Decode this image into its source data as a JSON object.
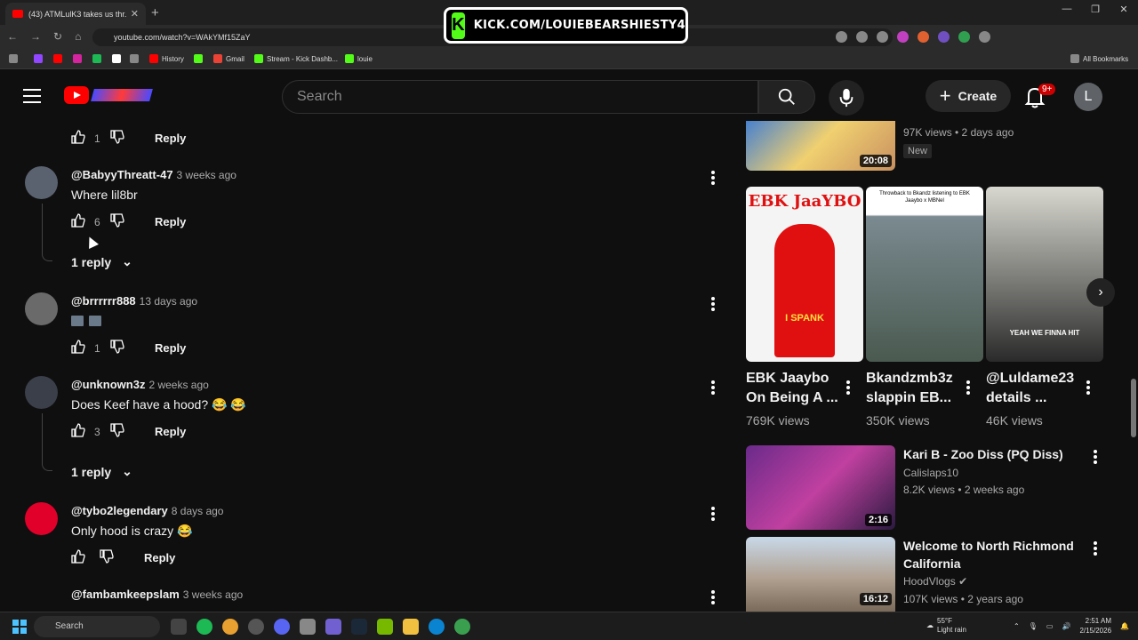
{
  "browser": {
    "tab_title": "(43) ATMLulK3 takes us thr...",
    "url": "youtube.com/watch?v=WAkYMf15ZaY",
    "bookmarks": [
      "History",
      "Gmail",
      "Stream - Kick Dashb...",
      "louie"
    ],
    "all_bookmarks": "All Bookmarks"
  },
  "overlay": {
    "kick_url": "KICK.COM/LOUIEBEARSHIESTY4"
  },
  "header": {
    "search_placeholder": "Search",
    "create_label": "Create",
    "notif_count": "9+",
    "avatar_letter": "L"
  },
  "comments": [
    {
      "likes": "1",
      "reply_label": "Reply"
    },
    {
      "handle": "@BabyyThreatt-47",
      "time": "3 weeks ago",
      "text": "Where lil8br",
      "likes": "6",
      "reply_label": "Reply",
      "replies": "1 reply"
    },
    {
      "handle": "@brrrrrr888",
      "time": "13 days ago",
      "text": "",
      "likes": "1",
      "reply_label": "Reply"
    },
    {
      "handle": "@unknown3z",
      "time": "2 weeks ago",
      "text": "Does Keef have a hood? 😂 😂",
      "likes": "3",
      "reply_label": "Reply",
      "replies": "1 reply"
    },
    {
      "handle": "@tybo2legendary",
      "time": "8 days ago",
      "text": "Only hood is crazy 😂",
      "likes": "",
      "reply_label": "Reply"
    },
    {
      "handle": "@fambamkeepslam",
      "time": "3 weeks ago"
    }
  ],
  "sidebar": {
    "top_video": {
      "duration": "20:08",
      "meta": "97K views • 2 days ago",
      "badge": "New"
    },
    "shorts": [
      {
        "title_1": "EBK Jaaybo",
        "title_2": "On Being A ...",
        "views": "769K views",
        "thumb_caption": "EBK JaaYBO",
        "thumb_sub": "I SPANK"
      },
      {
        "title_1": "Bkandzmb3z",
        "title_2": "slappin EB...",
        "views": "350K views",
        "thumb_caption": "Throwback to Bkandz listening to EBK Jaaybo x MBNel"
      },
      {
        "title_1": "@Luldame23",
        "title_2": "details ...",
        "views": "46K views",
        "thumb_caption": "YEAH WE FINNA HIT"
      }
    ],
    "videos": [
      {
        "title": "Kari B - Zoo Diss (PQ Diss)",
        "channel": "Calislaps10",
        "meta": "8.2K views • 2 weeks ago",
        "duration": "2:16"
      },
      {
        "title_1": "Welcome to North Richmond",
        "title_2": "California",
        "channel": "HoodVlogs",
        "meta": "107K views • 2 years ago",
        "duration": "16:12"
      }
    ]
  },
  "taskbar": {
    "search_label": "Search",
    "temp": "55°F",
    "weather": "Light rain",
    "time": "2:51 AM",
    "date": "2/15/2026"
  }
}
